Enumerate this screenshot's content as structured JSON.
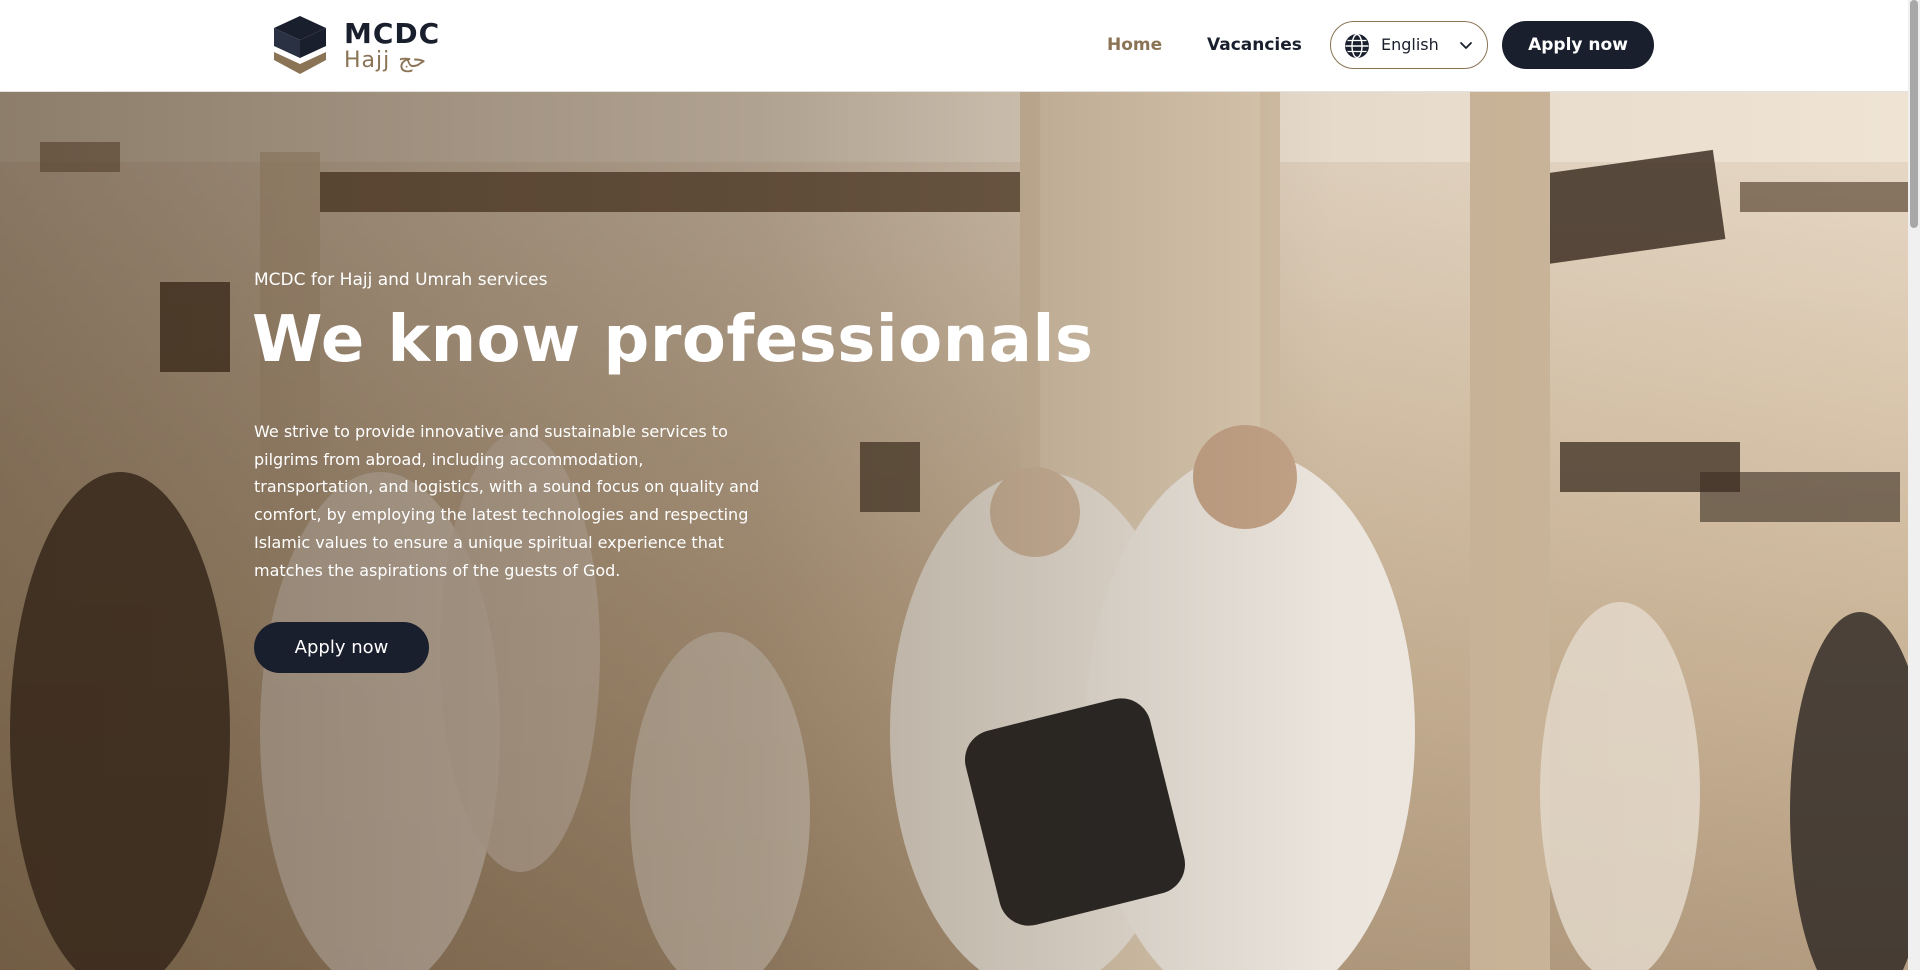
{
  "brand": {
    "name": "MCDC",
    "subtitle": "Hajj حج",
    "logo_icon": "kaaba-logo-icon"
  },
  "nav": {
    "links": [
      {
        "label": "Home",
        "active": true
      },
      {
        "label": "Vacancies",
        "active": false
      }
    ],
    "language": {
      "value": "English",
      "icon": "globe-icon",
      "chevron": "chevron-down-icon"
    },
    "apply_label": "Apply now"
  },
  "hero": {
    "eyebrow": "MCDC for Hajj and Umrah services",
    "title": "We know professionals",
    "description": "We strive to provide innovative and sustainable services to pilgrims from abroad, including accommodation, transportation, and logistics, with a sound focus on quality and comfort, by employing the latest technologies and respecting Islamic values to ensure a unique spiritual experience that matches the aspirations of the guests of God.",
    "apply_label": "Apply now"
  },
  "colors": {
    "accent": "#8b7355",
    "dark": "#1a1f2e",
    "white": "#ffffff"
  }
}
